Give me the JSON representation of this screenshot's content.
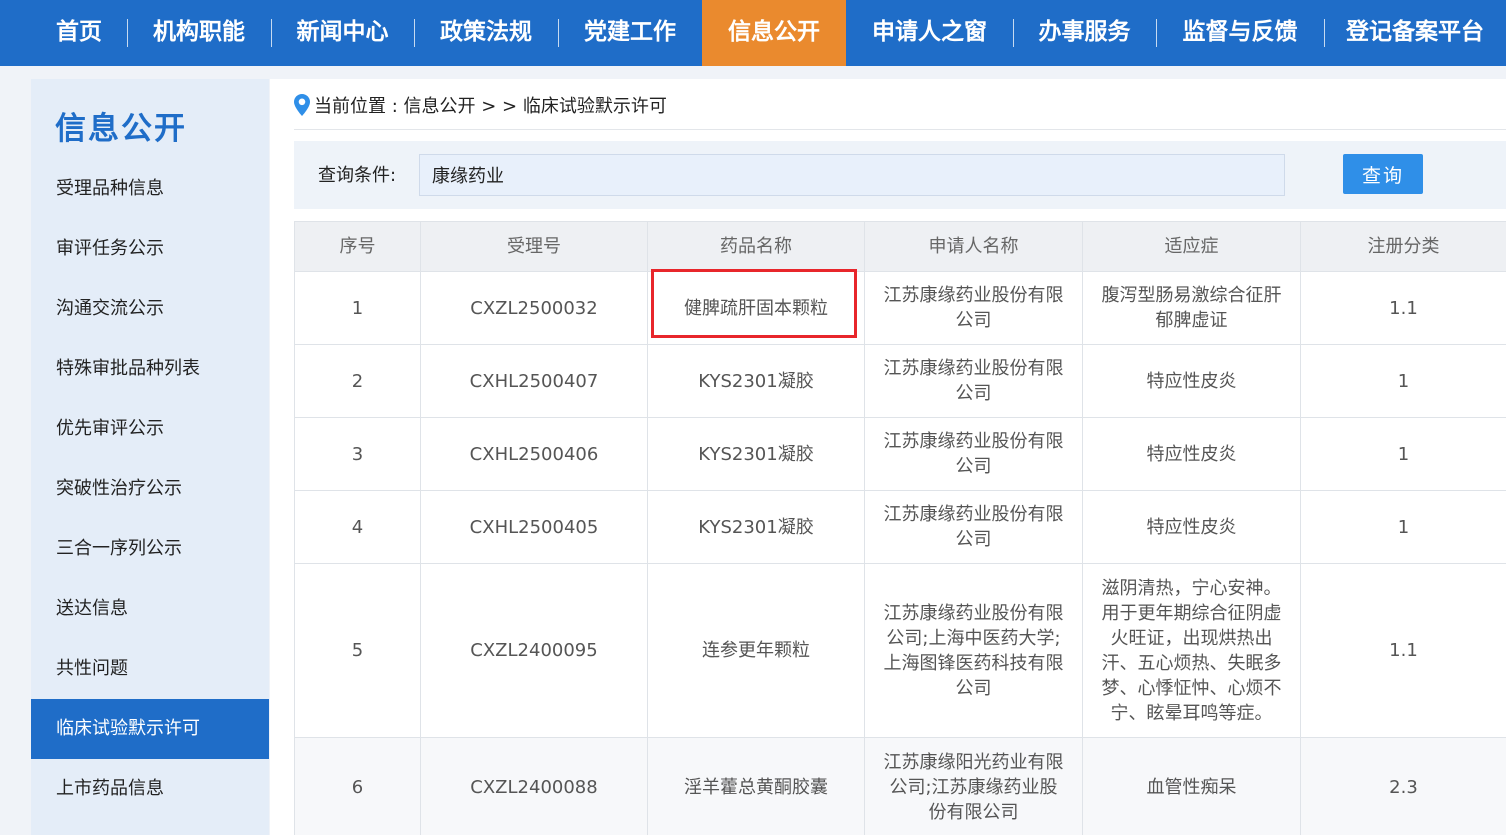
{
  "nav": {
    "items": [
      "首页",
      "机构职能",
      "新闻中心",
      "政策法规",
      "党建工作",
      "信息公开",
      "申请人之窗",
      "办事服务",
      "监督与反馈",
      "登记备案平台"
    ],
    "active_index": 5
  },
  "sidebar": {
    "title": "信息公开",
    "items": [
      "受理品种信息",
      "审评任务公示",
      "沟通交流公示",
      "特殊审批品种列表",
      "优先审评公示",
      "突破性治疗公示",
      "三合一序列公示",
      "送达信息",
      "共性问题",
      "临床试验默示许可",
      "上市药品信息"
    ],
    "active_index": 9
  },
  "breadcrumb": {
    "text": "当前位置 : 信息公开 > > 临床试验默示许可"
  },
  "search": {
    "label": "查询条件:",
    "value": "康缘药业",
    "button": "查询"
  },
  "table": {
    "headers": [
      "序号",
      "受理号",
      "药品名称",
      "申请人名称",
      "适应症",
      "注册分类"
    ],
    "rows": [
      [
        "1",
        "CXZL2500032",
        "健脾疏肝固本颗粒",
        "江苏康缘药业股份有限公司",
        "腹泻型肠易激综合征肝郁脾虚证",
        "1.1"
      ],
      [
        "2",
        "CXHL2500407",
        "KYS2301凝胶",
        "江苏康缘药业股份有限公司",
        "特应性皮炎",
        "1"
      ],
      [
        "3",
        "CXHL2500406",
        "KYS2301凝胶",
        "江苏康缘药业股份有限公司",
        "特应性皮炎",
        "1"
      ],
      [
        "4",
        "CXHL2500405",
        "KYS2301凝胶",
        "江苏康缘药业股份有限公司",
        "特应性皮炎",
        "1"
      ],
      [
        "5",
        "CXZL2400095",
        "连参更年颗粒",
        "江苏康缘药业股份有限公司;上海中医药大学;上海图锋医药科技有限公司",
        "滋阴清热，宁心安神。用于更年期综合征阴虚火旺证，出现烘热出汗、五心烦热、失眠多梦、心悸怔忡、心烦不宁、眩晕耳鸣等症。",
        "1.1"
      ],
      [
        "6",
        "CXZL2400088",
        "淫羊藿总黄酮胶囊",
        "江苏康缘阳光药业有限公司;江苏康缘药业股份有限公司",
        "血管性痴呆",
        "2.3"
      ]
    ]
  },
  "colors": {
    "nav_bg": "#1f6dc8",
    "nav_active": "#ea8a2e",
    "button": "#2f8fe8",
    "highlight": "#e8262b"
  }
}
